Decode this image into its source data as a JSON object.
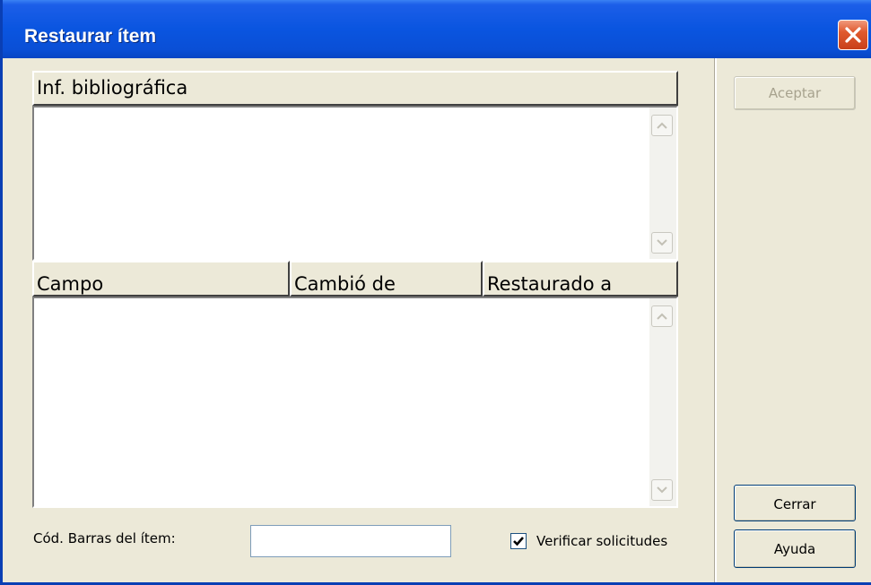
{
  "window": {
    "title": "Restaurar ítem"
  },
  "biblio": {
    "header": "Inf. bibliográfica"
  },
  "changes": {
    "columns": [
      "Campo",
      "Cambió de",
      "Restaurado a"
    ]
  },
  "barcode": {
    "label": "Cód. Barras del ítem:",
    "value": ""
  },
  "verify": {
    "label": "Verificar solicitudes",
    "checked": true
  },
  "buttons": {
    "accept": "Aceptar",
    "close": "Cerrar",
    "help": "Ayuda"
  },
  "icons": {
    "close": "close-icon",
    "scroll_up": "chevron-up-icon",
    "scroll_down": "chevron-down-icon",
    "check": "check-icon"
  },
  "colors": {
    "titlebar": "#0a55e0",
    "window_bg": "#ece9d8",
    "close": "#e05a2e"
  }
}
